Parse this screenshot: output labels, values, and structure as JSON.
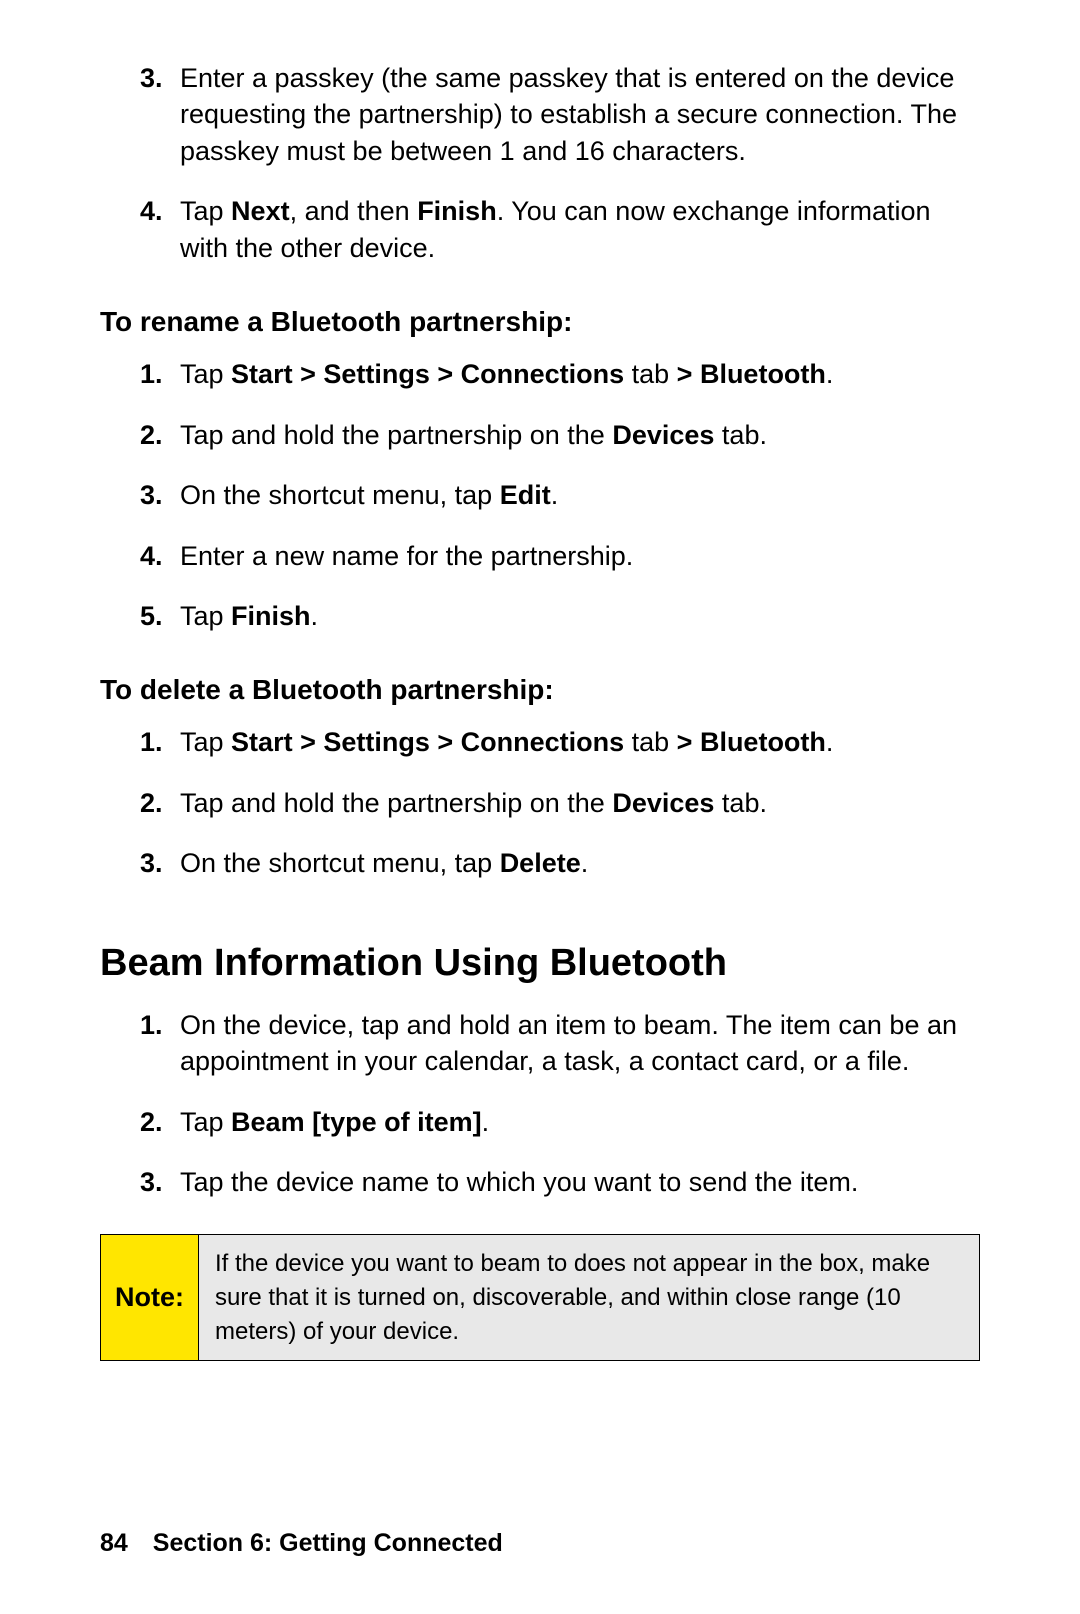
{
  "top_list": [
    {
      "n": "3.",
      "runs": [
        {
          "t": "Enter a passkey (the same passkey that is entered on the device requesting the partnership) to establish a secure connection. The passkey must be between 1 and 16 characters."
        }
      ]
    },
    {
      "n": "4.",
      "runs": [
        {
          "t": "Tap "
        },
        {
          "t": "Next",
          "b": true
        },
        {
          "t": ", and then "
        },
        {
          "t": "Finish",
          "b": true
        },
        {
          "t": ". You can now exchange information with the other device."
        }
      ]
    }
  ],
  "subhead_rename": "To rename a Bluetooth partnership:",
  "rename_list": [
    {
      "n": "1.",
      "runs": [
        {
          "t": "Tap "
        },
        {
          "t": "Start > Settings > Connections",
          "b": true
        },
        {
          "t": " tab "
        },
        {
          "t": "> Bluetooth",
          "b": true
        },
        {
          "t": "."
        }
      ]
    },
    {
      "n": "2.",
      "runs": [
        {
          "t": "Tap and hold the partnership on the "
        },
        {
          "t": "Devices",
          "b": true
        },
        {
          "t": " tab."
        }
      ]
    },
    {
      "n": "3.",
      "runs": [
        {
          "t": "On the shortcut menu, tap "
        },
        {
          "t": "Edit",
          "b": true
        },
        {
          "t": "."
        }
      ]
    },
    {
      "n": "4.",
      "runs": [
        {
          "t": "Enter a new name for the partnership."
        }
      ]
    },
    {
      "n": "5.",
      "runs": [
        {
          "t": "Tap "
        },
        {
          "t": "Finish",
          "b": true
        },
        {
          "t": "."
        }
      ]
    }
  ],
  "subhead_delete": "To delete a Bluetooth partnership:",
  "delete_list": [
    {
      "n": "1.",
      "runs": [
        {
          "t": "Tap "
        },
        {
          "t": "Start > Settings > Connections",
          "b": true
        },
        {
          "t": " tab "
        },
        {
          "t": "> Bluetooth",
          "b": true
        },
        {
          "t": "."
        }
      ]
    },
    {
      "n": "2.",
      "runs": [
        {
          "t": "Tap and hold the partnership on the "
        },
        {
          "t": "Devices",
          "b": true
        },
        {
          "t": " tab."
        }
      ]
    },
    {
      "n": "3.",
      "runs": [
        {
          "t": "On the shortcut menu, tap "
        },
        {
          "t": "Delete",
          "b": true
        },
        {
          "t": "."
        }
      ]
    }
  ],
  "h2_beam": "Beam Information Using Bluetooth",
  "beam_list": [
    {
      "n": "1.",
      "runs": [
        {
          "t": "On the device, tap and hold an item to beam. The item can be an appointment in your calendar, a task, a contact card, or a file."
        }
      ]
    },
    {
      "n": "2.",
      "runs": [
        {
          "t": "Tap "
        },
        {
          "t": "Beam [type of item]",
          "b": true
        },
        {
          "t": "."
        }
      ]
    },
    {
      "n": "3.",
      "runs": [
        {
          "t": "Tap the device name to which you want to send the item."
        }
      ]
    }
  ],
  "note": {
    "label": "Note:",
    "body": "If the device you want to beam to does not appear in the box, make sure that it is turned on, discoverable, and within close range (10 meters) of your device."
  },
  "footer": {
    "page": "84",
    "section": "Section 6: Getting Connected"
  }
}
